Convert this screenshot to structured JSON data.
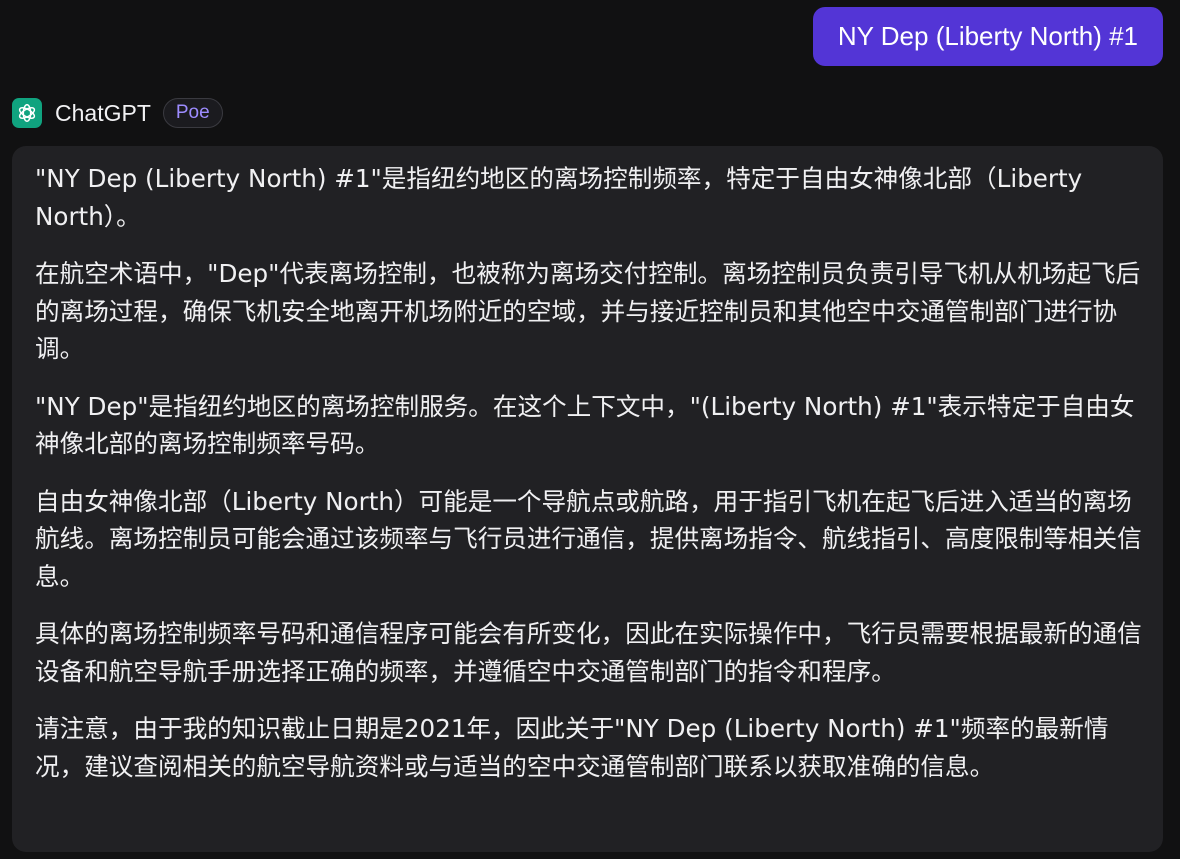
{
  "user_message": {
    "text": "NY Dep (Liberty North) #1"
  },
  "bot": {
    "avatar_icon": "openai-logo-icon",
    "avatar_color": "#10a37f",
    "name": "ChatGPT",
    "badge": "Poe",
    "badge_color": "#9d8cff",
    "paragraphs": [
      "\"NY Dep (Liberty North) #1\"是指纽约地区的离场控制频率，特定于自由女神像北部（Liberty North）。",
      "在航空术语中，\"Dep\"代表离场控制，也被称为离场交付控制。离场控制员负责引导飞机从机场起飞后的离场过程，确保飞机安全地离开机场附近的空域，并与接近控制员和其他空中交通管制部门进行协调。",
      "\"NY Dep\"是指纽约地区的离场控制服务。在这个上下文中，\"(Liberty North) #1\"表示特定于自由女神像北部的离场控制频率号码。",
      "自由女神像北部（Liberty North）可能是一个导航点或航路，用于指引飞机在起飞后进入适当的离场航线。离场控制员可能会通过该频率与飞行员进行通信，提供离场指令、航线指引、高度限制等相关信息。",
      "具体的离场控制频率号码和通信程序可能会有所变化，因此在实际操作中，飞行员需要根据最新的通信设备和航空导航手册选择正确的频率，并遵循空中交通管制部门的指令和程序。",
      "请注意，由于我的知识截止日期是2021年，因此关于\"NY Dep (Liberty North) #1\"频率的最新情况，建议查阅相关的航空导航资料或与适当的空中交通管制部门联系以获取准确的信息。"
    ]
  },
  "colors": {
    "background": "#111112",
    "user_bubble": "#5335d6",
    "bot_bubble": "#212124"
  }
}
